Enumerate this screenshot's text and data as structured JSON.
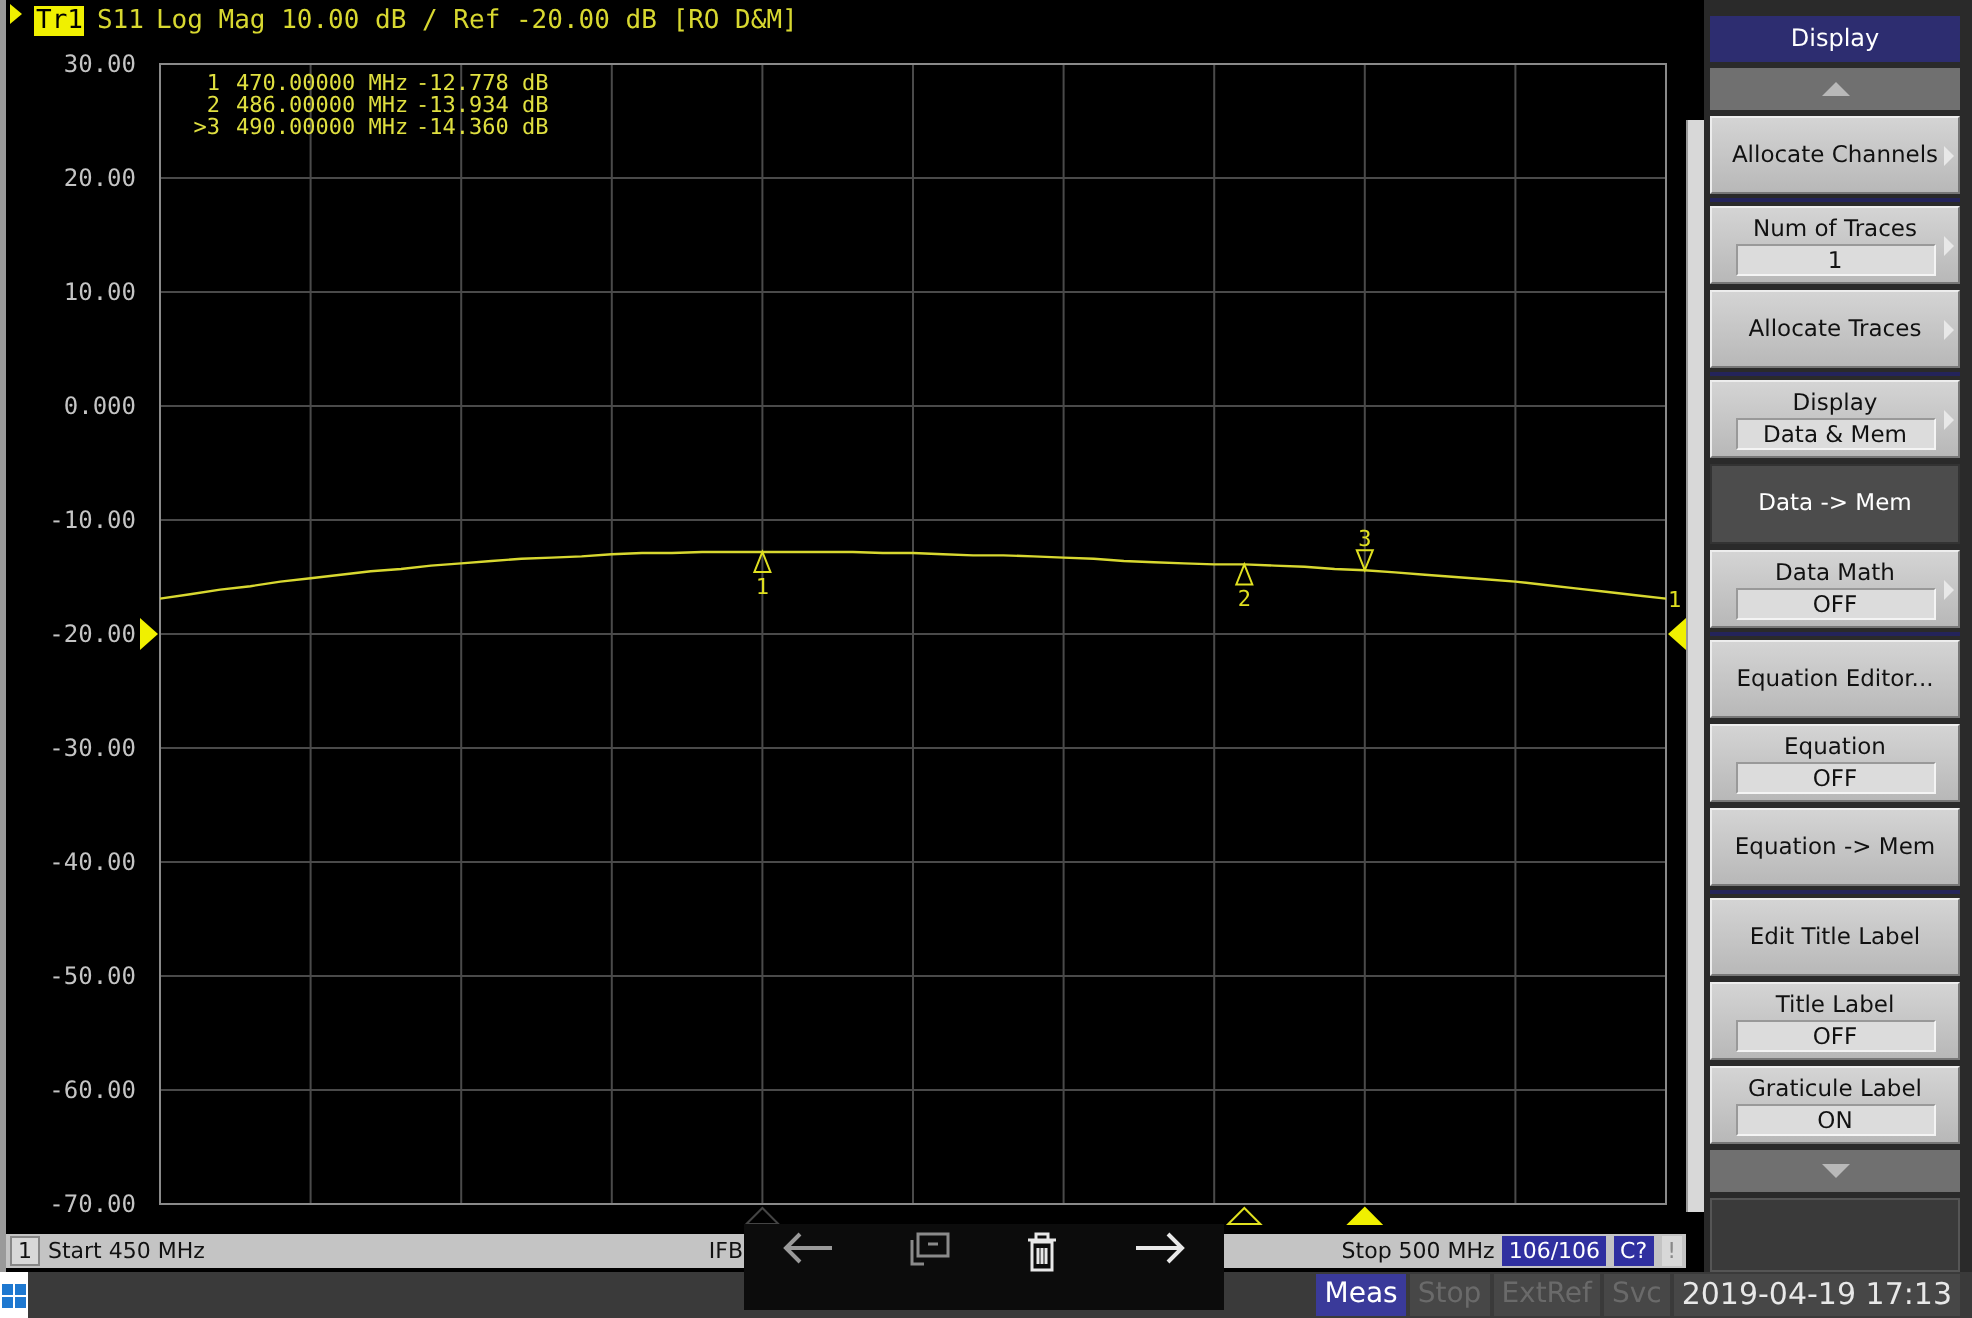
{
  "header": {
    "trace": "Tr1",
    "text": "Log Mag 10.00 dB / Ref -20.00 dB [RO D&M]"
  },
  "marker_readout": [
    {
      "label": "1",
      "frequency": "470.00000 MHz",
      "value": "-12.778 dB"
    },
    {
      "label": "2",
      "frequency": "486.00000 MHz",
      "value": "-13.934 dB"
    },
    {
      "label": ">3",
      "frequency": "490.00000 MHz",
      "value": "-14.360 dB"
    }
  ],
  "plot": {
    "trace_label": "1",
    "markers": [
      {
        "label": "1",
        "kind": "dim",
        "active": false
      },
      {
        "label": "2",
        "kind": "hollow",
        "active": false
      },
      {
        "label": "3",
        "kind": "filled",
        "active": true
      }
    ],
    "chart_data": {
      "type": "line",
      "categories": [
        null,
        null,
        null,
        null,
        null,
        null,
        null,
        null,
        null,
        null,
        null,
        null,
        null,
        null,
        null,
        null,
        null,
        null,
        null,
        null,
        null,
        null,
        null,
        null,
        null,
        null,
        null,
        null,
        null,
        null,
        null,
        null,
        null,
        null,
        null,
        null,
        null,
        null,
        null,
        null,
        null,
        null,
        null,
        null,
        null,
        null,
        null,
        null,
        null,
        null,
        null
      ],
      "series": [
        {
          "name": "S11",
          "color": "#d8d830",
          "values": [
            -16.9,
            -16.5,
            -16.1,
            -15.8,
            -15.4,
            -15.1,
            -14.8,
            -14.5,
            -14.3,
            -14.0,
            -13.8,
            -13.6,
            -13.4,
            -13.3,
            -13.2,
            -13.0,
            -12.9,
            -12.9,
            -12.8,
            -12.8,
            -12.8,
            -12.8,
            -12.8,
            -12.8,
            -12.9,
            -12.9,
            -13.0,
            -13.1,
            -13.1,
            -13.2,
            -13.3,
            -13.4,
            -13.6,
            -13.7,
            -13.8,
            -13.9,
            -13.9,
            -14.0,
            -14.1,
            -14.3,
            -14.4,
            -14.6,
            -14.8,
            -15.0,
            -15.2,
            -15.4,
            -15.7,
            -16.0,
            -16.3,
            -16.6,
            -16.9
          ]
        }
      ],
      "ylim": [
        -70,
        30
      ],
      "grid": true,
      "yticks": [
        {
          "value": 30,
          "label": "30.00"
        },
        {
          "value": 20,
          "label": "20.00"
        },
        {
          "value": 10,
          "label": "10.00"
        },
        {
          "value": 0,
          "label": "0.000"
        },
        {
          "value": -10,
          "label": "-10.00"
        },
        {
          "value": -20,
          "label": "-20.00"
        },
        {
          "value": -30,
          "label": "-30.00"
        },
        {
          "value": -40,
          "label": "-40.00"
        },
        {
          "value": -50,
          "label": "-50.00"
        },
        {
          "value": -60,
          "label": "-60.00"
        },
        {
          "value": -70,
          "label": "-70.00"
        }
      ]
    }
  },
  "softkeys": {
    "title": "Display",
    "buttons": [
      {
        "label": "Allocate Channels",
        "submenu": true,
        "selected": false,
        "group_end": true
      },
      {
        "label": "Num of Traces",
        "value": "1",
        "submenu": true,
        "selected": false,
        "group_end": false
      },
      {
        "label": "Allocate Traces",
        "submenu": true,
        "selected": false,
        "group_end": true
      },
      {
        "label": "Display",
        "value": "Data & Mem",
        "submenu": true,
        "selected": false,
        "group_end": false
      },
      {
        "label": "Data -> Mem",
        "submenu": false,
        "selected": true,
        "group_end": false
      },
      {
        "label": "Data Math",
        "value": "OFF",
        "submenu": true,
        "selected": false,
        "group_end": true
      },
      {
        "label": "Equation Editor...",
        "submenu": false,
        "selected": false,
        "group_end": false
      },
      {
        "label": "Equation",
        "value": "OFF",
        "submenu": false,
        "selected": false,
        "group_end": false
      },
      {
        "label": "Equation -> Mem",
        "submenu": false,
        "selected": false,
        "group_end": true
      },
      {
        "label": "Edit Title Label",
        "submenu": false,
        "selected": false,
        "group_end": false
      },
      {
        "label": "Title Label",
        "value": "OFF",
        "submenu": false,
        "selected": false,
        "group_end": false
      },
      {
        "label": "Graticule Label",
        "value": "ON",
        "submenu": false,
        "selected": false,
        "group_end": false
      }
    ]
  },
  "status_bar": {
    "channel": "1",
    "start": "Start 450 MHz",
    "ifbw": "IFB",
    "stop": "Stop 500 MHz",
    "points": "106/106",
    "cal": "C?",
    "warning": "!"
  },
  "taskbar": {
    "items": [
      {
        "label": "Meas",
        "on": true
      },
      {
        "label": "Stop",
        "on": false
      },
      {
        "label": "ExtRef",
        "on": false
      },
      {
        "label": "Svc",
        "on": false
      }
    ],
    "datetime": "2019-04-19 17:13"
  }
}
